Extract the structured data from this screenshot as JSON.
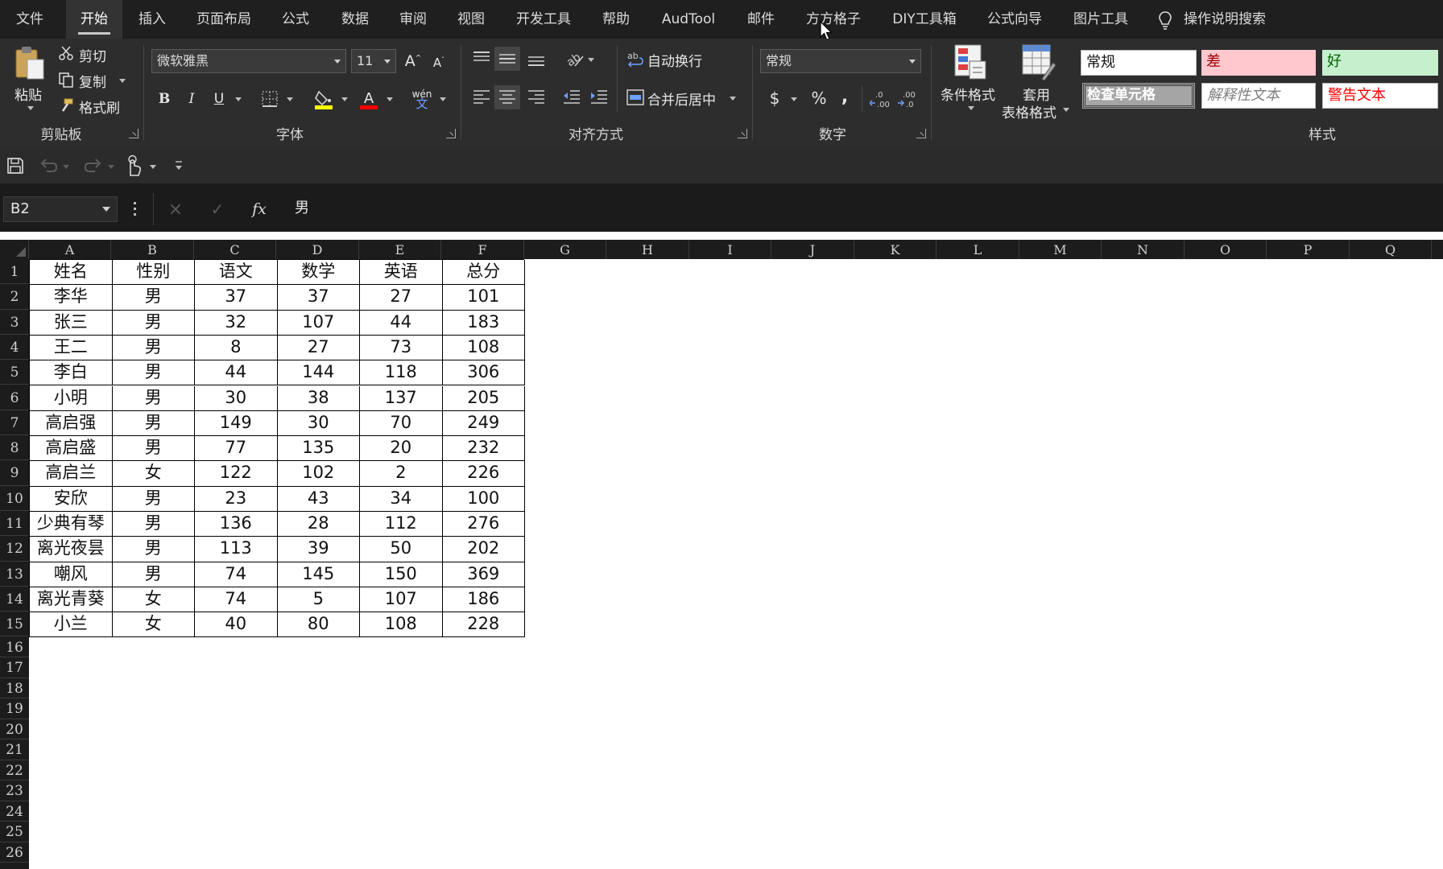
{
  "menu": {
    "tabs": [
      "文件",
      "开始",
      "插入",
      "页面布局",
      "公式",
      "数据",
      "审阅",
      "视图",
      "开发工具",
      "帮助",
      "AudTool",
      "邮件",
      "方方格子",
      "DIY工具箱",
      "公式向导",
      "图片工具"
    ],
    "active": "开始",
    "search_label": "操作说明搜索"
  },
  "ribbon": {
    "clipboard": {
      "paste": "粘贴",
      "cut": "剪切",
      "copy": "复制",
      "format_painter": "格式刷",
      "group": "剪贴板"
    },
    "font": {
      "name": "微软雅黑",
      "size": "11",
      "bold": "B",
      "italic": "I",
      "underline": "U",
      "group": "字体",
      "phonetic": "wén"
    },
    "alignment": {
      "wrap": "自动换行",
      "merge": "合并后居中",
      "group": "对齐方式"
    },
    "number": {
      "format": "常规",
      "group": "数字"
    },
    "styles": {
      "conditional": "条件格式",
      "table_format_1": "套用",
      "table_format_2": "表格格式",
      "group": "样式",
      "normal": "常规",
      "bad": "差",
      "good": "好",
      "check_cell": "检查单元格",
      "explanatory": "解释性文本",
      "warning": "警告文本"
    }
  },
  "colors": {
    "bad_bg": "#ffc7ce",
    "bad_fg": "#9c0006",
    "good_bg": "#c6efce",
    "good_fg": "#006100",
    "check_bg": "#a5a5a5",
    "warning_fg": "#ff0000"
  },
  "formula_bar": {
    "name_box": "B2",
    "formula": "男"
  },
  "grid": {
    "columns": [
      "A",
      "B",
      "C",
      "D",
      "E",
      "F",
      "G",
      "H",
      "I",
      "J",
      "K",
      "L",
      "M",
      "N",
      "O",
      "P",
      "Q"
    ],
    "rows": [
      "1",
      "2",
      "3",
      "4",
      "5",
      "6",
      "7",
      "8",
      "9",
      "10",
      "11",
      "12",
      "13",
      "14",
      "15",
      "16",
      "17",
      "18",
      "19",
      "20",
      "21",
      "22",
      "23",
      "24",
      "25",
      "26"
    ]
  },
  "table": {
    "headers": [
      "姓名",
      "性别",
      "语文",
      "数学",
      "英语",
      "总分"
    ],
    "rows": [
      [
        "李华",
        "男",
        "37",
        "37",
        "27",
        "101"
      ],
      [
        "张三",
        "男",
        "32",
        "107",
        "44",
        "183"
      ],
      [
        "王二",
        "男",
        "8",
        "27",
        "73",
        "108"
      ],
      [
        "李白",
        "男",
        "44",
        "144",
        "118",
        "306"
      ],
      [
        "小明",
        "男",
        "30",
        "38",
        "137",
        "205"
      ],
      [
        "高启强",
        "男",
        "149",
        "30",
        "70",
        "249"
      ],
      [
        "高启盛",
        "男",
        "77",
        "135",
        "20",
        "232"
      ],
      [
        "高启兰",
        "女",
        "122",
        "102",
        "2",
        "226"
      ],
      [
        "安欣",
        "男",
        "23",
        "43",
        "34",
        "100"
      ],
      [
        "少典有琴",
        "男",
        "136",
        "28",
        "112",
        "276"
      ],
      [
        "离光夜昙",
        "男",
        "113",
        "39",
        "50",
        "202"
      ],
      [
        "嘲风",
        "男",
        "74",
        "145",
        "150",
        "369"
      ],
      [
        "离光青葵",
        "女",
        "74",
        "5",
        "107",
        "186"
      ],
      [
        "小兰",
        "女",
        "40",
        "80",
        "108",
        "228"
      ]
    ]
  }
}
